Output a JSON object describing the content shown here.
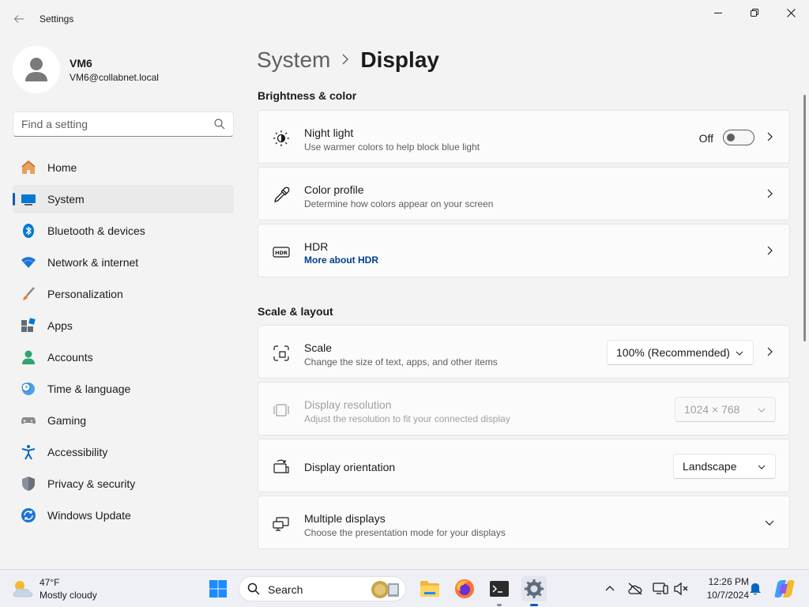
{
  "window": {
    "title": "Settings"
  },
  "profile": {
    "name": "VM6",
    "email": "VM6@collabnet.local"
  },
  "search": {
    "placeholder": "Find a setting"
  },
  "nav": {
    "items": [
      {
        "label": "Home",
        "icon": "home-icon"
      },
      {
        "label": "System",
        "icon": "system-icon"
      },
      {
        "label": "Bluetooth & devices",
        "icon": "bluetooth-icon"
      },
      {
        "label": "Network & internet",
        "icon": "wifi-icon"
      },
      {
        "label": "Personalization",
        "icon": "brush-icon"
      },
      {
        "label": "Apps",
        "icon": "apps-icon"
      },
      {
        "label": "Accounts",
        "icon": "account-icon"
      },
      {
        "label": "Time & language",
        "icon": "clock-globe-icon"
      },
      {
        "label": "Gaming",
        "icon": "gamepad-icon"
      },
      {
        "label": "Accessibility",
        "icon": "accessibility-icon"
      },
      {
        "label": "Privacy & security",
        "icon": "shield-icon"
      },
      {
        "label": "Windows Update",
        "icon": "update-icon"
      }
    ],
    "active": "System"
  },
  "breadcrumb": {
    "parent": "System",
    "current": "Display"
  },
  "sections": {
    "brightness_title": "Brightness & color",
    "scale_title": "Scale & layout"
  },
  "cards": {
    "night_light": {
      "title": "Night light",
      "desc": "Use warmer colors to help block blue light",
      "toggle_state": "Off"
    },
    "color_profile": {
      "title": "Color profile",
      "desc": "Determine how colors appear on your screen"
    },
    "hdr": {
      "title": "HDR",
      "link": "More about HDR"
    },
    "scale": {
      "title": "Scale",
      "desc": "Change the size of text, apps, and other items",
      "value": "100% (Recommended)"
    },
    "resolution": {
      "title": "Display resolution",
      "desc": "Adjust the resolution to fit your connected display",
      "value": "1024 × 768"
    },
    "orientation": {
      "title": "Display orientation",
      "value": "Landscape"
    },
    "multiple": {
      "title": "Multiple displays",
      "desc": "Choose the presentation mode for your displays"
    }
  },
  "taskbar": {
    "weather_temp": "47°F",
    "weather_desc": "Mostly cloudy",
    "search_label": "Search",
    "time": "12:26 PM",
    "date": "10/7/2024"
  },
  "colors": {
    "accent": "#005fb8",
    "link": "#003e92",
    "background": "#f3f3f3",
    "card": "#fbfbfb"
  }
}
